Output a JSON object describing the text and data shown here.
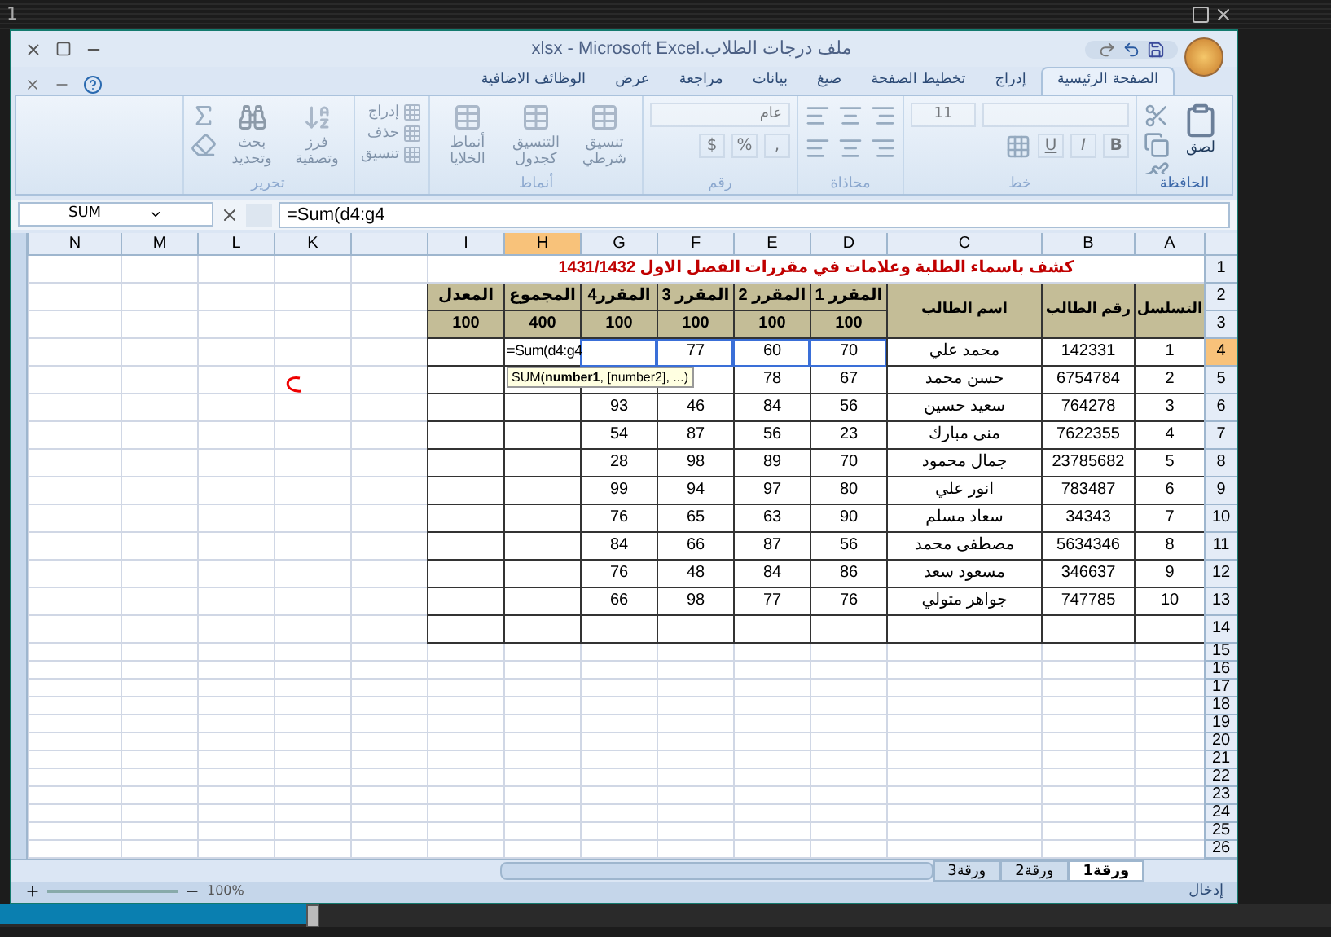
{
  "screen": {
    "corner_label": "1"
  },
  "window": {
    "title": "ملف درجات الطلاب.xlsx - Microsoft Excel"
  },
  "tabs": [
    {
      "label": "الصفحة الرئيسية",
      "selected": true
    },
    {
      "label": "إدراج",
      "selected": false
    },
    {
      "label": "تخطيط الصفحة",
      "selected": false
    },
    {
      "label": "صيغ",
      "selected": false
    },
    {
      "label": "بيانات",
      "selected": false
    },
    {
      "label": "مراجعة",
      "selected": false
    },
    {
      "label": "عرض",
      "selected": false
    },
    {
      "label": "الوظائف الاضافية",
      "selected": false
    }
  ],
  "ribbon": {
    "groups": [
      {
        "kind": "clipboard",
        "label": "الحافظة",
        "disabled": false,
        "buttons": [
          "لصق"
        ]
      },
      {
        "kind": "font",
        "label": "خط",
        "disabled": true,
        "font_size": "11",
        "style_buttons": [
          "B",
          "I",
          "U"
        ]
      },
      {
        "kind": "alignment",
        "label": "محاذاة",
        "disabled": true
      },
      {
        "kind": "number",
        "label": "رقم",
        "disabled": true,
        "format": "عام",
        "symbols": [
          ",",
          "%",
          "$"
        ]
      },
      {
        "kind": "styles",
        "label": "أنماط",
        "disabled": true,
        "buttons": [
          "تنسيق شرطي",
          "التنسيق كجدول",
          "أنماط الخلايا"
        ]
      },
      {
        "kind": "cells",
        "disabled": true,
        "buttons": [
          "إدراج",
          "حذف",
          "تنسيق"
        ]
      },
      {
        "kind": "editing",
        "label": "تحرير",
        "disabled": true,
        "buttons": [
          "فرز وتصفية",
          "بحث وتحديد"
        ]
      }
    ]
  },
  "formula_bar": {
    "name_box": "SUM",
    "formula": "=Sum(d4:g4"
  },
  "sheet": {
    "columns": [
      {
        "label": "A",
        "selected": false
      },
      {
        "label": "B",
        "selected": false
      },
      {
        "label": "C",
        "selected": false
      },
      {
        "label": "D",
        "selected": false
      },
      {
        "label": "E",
        "selected": false
      },
      {
        "label": "F",
        "selected": false
      },
      {
        "label": "G",
        "selected": false
      },
      {
        "label": "H",
        "selected": true
      },
      {
        "label": "I",
        "selected": false
      },
      {
        "selected": false
      },
      {
        "label": "K",
        "selected": false
      },
      {
        "label": "L",
        "selected": false
      },
      {
        "label": "M",
        "selected": false
      },
      {
        "label": "N",
        "selected": false
      }
    ],
    "row_numbers": [
      {
        "label": "1",
        "selected": false
      },
      {
        "label": "2",
        "selected": false
      },
      {
        "label": "3",
        "selected": false
      },
      {
        "label": "4",
        "selected": true
      },
      {
        "label": "5",
        "selected": false
      },
      {
        "label": "6",
        "selected": false
      },
      {
        "label": "7",
        "selected": false
      },
      {
        "label": "8",
        "selected": false
      },
      {
        "label": "9",
        "selected": false
      },
      {
        "label": "10",
        "selected": false
      },
      {
        "label": "11",
        "selected": false
      },
      {
        "label": "12",
        "selected": false
      },
      {
        "label": "13",
        "selected": false
      },
      {
        "label": "14",
        "selected": false
      },
      {
        "label": "15",
        "selected": false
      },
      {
        "label": "16",
        "selected": false
      },
      {
        "label": "17",
        "selected": false
      },
      {
        "label": "18",
        "selected": false
      },
      {
        "label": "19",
        "selected": false
      },
      {
        "label": "20",
        "selected": false
      },
      {
        "label": "21",
        "selected": false
      },
      {
        "label": "22",
        "selected": false
      },
      {
        "label": "23",
        "selected": false
      },
      {
        "label": "24",
        "selected": false
      },
      {
        "label": "25",
        "selected": false
      },
      {
        "label": "26",
        "selected": false
      }
    ],
    "title": "كشف باسماء الطلبة وعلامات في مقررات الفصل الاول 1431/1432",
    "headers": [
      "التسلسل",
      "رقم الطالب",
      "اسم الطالب",
      "المقرر 1",
      "المقرر 2",
      "المقرر 3",
      "المقرر4",
      "المجموع",
      "المعدل"
    ],
    "maximums": [
      "100",
      "100",
      "100",
      "100",
      "400",
      "100"
    ],
    "tooltip": "SUM(**number1**, [number2], ...)",
    "rows": [
      {
        "serial": "1",
        "student_id": "142331",
        "name": "محمد علي",
        "course_1": "70",
        "course_2": "60",
        "course_3": "77",
        "total": "=Sum(d4:g4",
        "referenced": true
      },
      {
        "serial": "2",
        "student_id": "6754784",
        "name": "حسن محمد",
        "course_1": "67",
        "course_2": "78",
        "referenced": false
      },
      {
        "serial": "3",
        "student_id": "764278",
        "name": "سعيد حسين",
        "course_1": "56",
        "course_2": "84",
        "course_3": "46",
        "course_4": "93",
        "referenced": false
      },
      {
        "serial": "4",
        "student_id": "7622355",
        "name": "منى مبارك",
        "course_1": "23",
        "course_2": "56",
        "course_3": "87",
        "course_4": "54",
        "referenced": false
      },
      {
        "serial": "5",
        "student_id": "23785682",
        "name": "جمال محمود",
        "course_1": "70",
        "course_2": "89",
        "course_3": "98",
        "course_4": "28",
        "referenced": false
      },
      {
        "serial": "6",
        "student_id": "783487",
        "name": "انور علي",
        "course_1": "80",
        "course_2": "97",
        "course_3": "94",
        "course_4": "99",
        "referenced": false
      },
      {
        "serial": "7",
        "student_id": "34343",
        "name": "سعاد مسلم",
        "course_1": "90",
        "course_2": "63",
        "course_3": "65",
        "course_4": "76",
        "referenced": false
      },
      {
        "serial": "8",
        "student_id": "5634346",
        "name": "مصطفى محمد",
        "course_1": "56",
        "course_2": "87",
        "course_3": "66",
        "course_4": "84",
        "referenced": false
      },
      {
        "serial": "9",
        "student_id": "346637",
        "name": "مسعود سعد",
        "course_1": "86",
        "course_2": "84",
        "course_3": "48",
        "course_4": "76",
        "referenced": false
      },
      {
        "serial": "10",
        "student_id": "747785",
        "name": "جواهر متولي",
        "course_1": "76",
        "course_2": "77",
        "course_3": "98",
        "course_4": "66",
        "referenced": false
      }
    ]
  },
  "sheet_tabs": [
    {
      "label": "ورقة1",
      "selected": true
    },
    {
      "label": "ورقة2",
      "selected": false
    },
    {
      "label": "ورقة3",
      "selected": false
    }
  ],
  "status_bar": {
    "mode": "إدخال",
    "zoom": "100%"
  },
  "player": {
    "level": 0.23
  }
}
